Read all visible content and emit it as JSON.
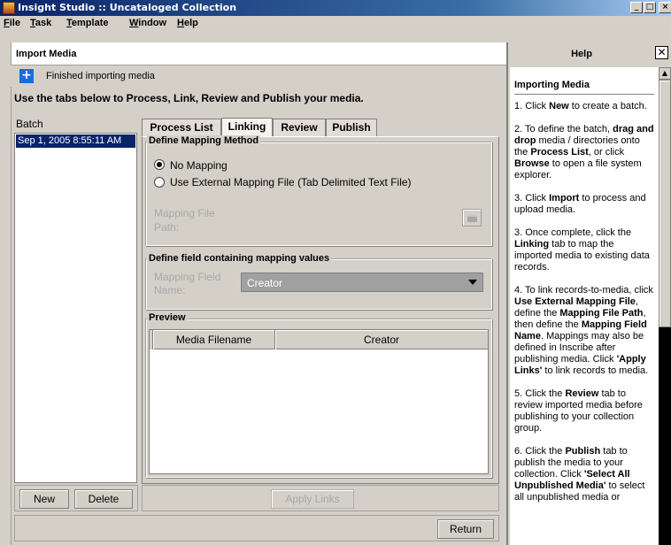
{
  "window": {
    "title": "Insight Studio :: Uncataloged Collection",
    "min": "_",
    "max": "□",
    "close": "×"
  },
  "menu": [
    {
      "label": "File",
      "u": "F",
      "rest": "ile"
    },
    {
      "label": "Task",
      "u": "T",
      "rest": "ask"
    },
    {
      "label": "Template",
      "u": "T",
      "rest": "emplate"
    },
    {
      "label": "Window",
      "u": "W",
      "rest": "indow"
    },
    {
      "label": "Help",
      "u": "H",
      "rest": "elp"
    }
  ],
  "import": {
    "header": "Import Media",
    "status": "Finished importing media",
    "instruction": "Use the tabs below to Process, Link, Review and Publish your media.",
    "batch_label": "Batch",
    "batches": [
      "Sep 1, 2005 8:55:11 AM"
    ],
    "tabs": [
      "Process List",
      "Linking",
      "Review",
      "Publish"
    ],
    "active_tab": "Linking",
    "mapping_method": {
      "legend": "Define Mapping Method",
      "options": [
        "No Mapping",
        "Use External Mapping File (Tab Delimited Text File)"
      ],
      "selected": "No Mapping",
      "file_path_label": "Mapping File Path:"
    },
    "mapping_field": {
      "legend": "Define field containing mapping values",
      "label": "Mapping Field Name:",
      "value": "Creator"
    },
    "preview": {
      "legend": "Preview",
      "columns": [
        "Media Filename",
        "Creator"
      ]
    },
    "buttons": {
      "new": "New",
      "delete": "Delete",
      "apply_links": "Apply Links",
      "return": "Return"
    }
  },
  "help": {
    "header": "Help",
    "close": "☒",
    "title": "Importing Media"
  },
  "colors": {
    "titlebar": "#0a246a",
    "face": "#d4d0c8",
    "accent": "#1a6cd8"
  }
}
